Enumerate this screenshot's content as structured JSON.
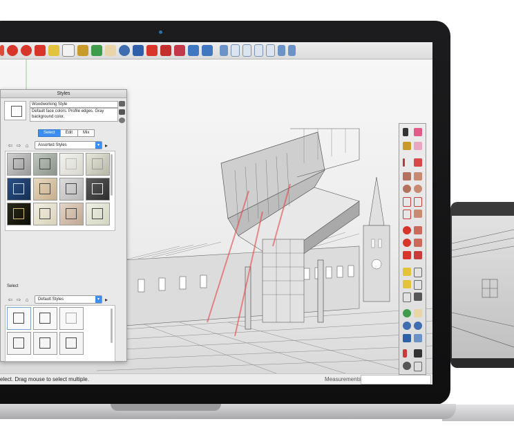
{
  "styles_panel": {
    "title": "Styles",
    "style_name": "Woodworking Style",
    "style_description": "Default face colors. Profile edges. Gray background color.",
    "tabs": [
      "Select",
      "Edit",
      "Mix"
    ],
    "active_tab": "Select",
    "library_top": "Assorted Styles",
    "section_label": "Select",
    "library_bottom": "Default Styles"
  },
  "statusbar": {
    "text": "elect. Drag mouse to select multiple.",
    "measurements_label": "Measurements"
  },
  "colors": {
    "accent_blue": "#3d8ef0",
    "bezel": "#161617",
    "red_highlight": "#e84646"
  }
}
